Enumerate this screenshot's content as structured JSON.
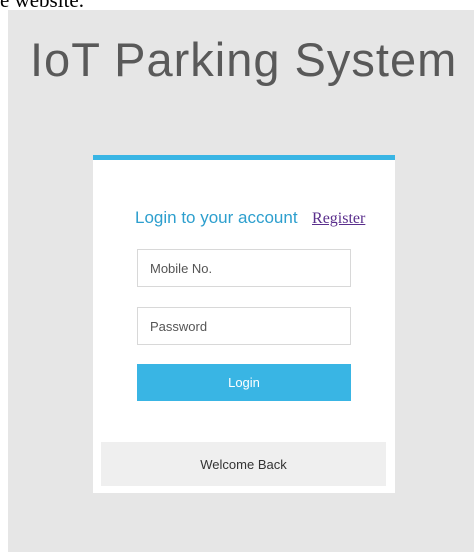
{
  "page": {
    "top_text_fragment": "e website."
  },
  "header": {
    "title": "IoT Parking System"
  },
  "login_card": {
    "heading": "Login to your account",
    "register_link": "Register",
    "mobile_placeholder": "Mobile No.",
    "mobile_value": "",
    "password_placeholder": "Password",
    "password_value": "",
    "login_button": "Login",
    "footer_text": "Welcome Back"
  },
  "colors": {
    "accent": "#39b5e4",
    "heading": "#2d9fce",
    "link": "#5a2e8c",
    "backdrop": "#e6e6e6",
    "title": "#595959"
  }
}
